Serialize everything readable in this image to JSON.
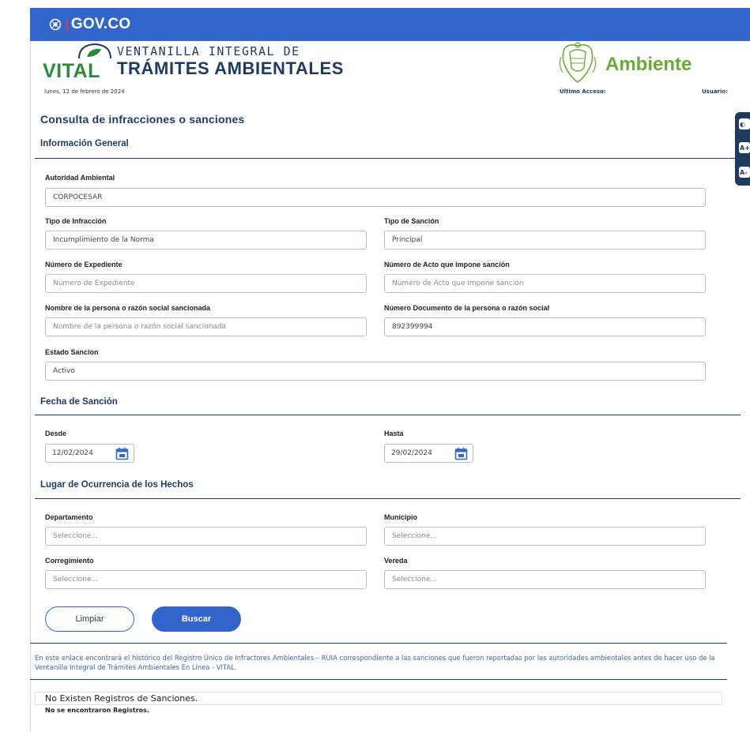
{
  "gov": {
    "brand": "GOV.CO"
  },
  "header": {
    "vital_word": "VITAL",
    "vital_line1": "VENTANILLA INTEGRAL DE",
    "vital_line2": "TRÁMITES AMBIENTALES",
    "date": "lunes, 12 de febrero de 2024",
    "ministry": "Ambiente",
    "last_access_label": "Último Acceso:",
    "user_label": "Usuario:"
  },
  "page": {
    "title": "Consulta de infracciones o sanciones"
  },
  "general": {
    "title": "Información General",
    "autoridad": {
      "label": "Autoridad Ambiental",
      "value": "CORPOCESAR"
    },
    "tipo_infraccion": {
      "label": "Tipo de Infracción",
      "value": "Incumplimiento de la Norma"
    },
    "tipo_sancion": {
      "label": "Tipo de Sanción",
      "value": "Principal"
    },
    "num_expediente": {
      "label": "Número de Expediente",
      "placeholder": "Número de Expediente"
    },
    "num_acto": {
      "label": "Número de Acto que impone sanción",
      "placeholder": "Número de Acto que impone sanción"
    },
    "nombre_persona": {
      "label": "Nombre de la persona o razón social sancionada",
      "placeholder": "Nombre de la persona o razón social sancionada"
    },
    "num_documento": {
      "label": "Número Documento de la persona o razón social",
      "value": "892399994"
    },
    "estado": {
      "label": "Estado Sancion",
      "value": "Activo"
    }
  },
  "fecha": {
    "title": "Fecha de Sanción",
    "desde": {
      "label": "Desde",
      "value": "12/02/2024"
    },
    "hasta": {
      "label": "Hasta",
      "value": "29/02/2024"
    }
  },
  "lugar": {
    "title": "Lugar de Ocurrencia de los Hechos",
    "departamento": {
      "label": "Departamento",
      "value": "Seleccione..."
    },
    "municipio": {
      "label": "Municipio",
      "value": "Seleccione..."
    },
    "corregimiento": {
      "label": "Corregimiento",
      "value": "Seleccione..."
    },
    "vereda": {
      "label": "Vereda",
      "value": "Seleccione..."
    }
  },
  "actions": {
    "limpiar": "Limpiar",
    "buscar": "Buscar"
  },
  "ruia": {
    "text": "En este enlace encontrará el histórico del Registro Único de Infractores Ambientales – RUIA correspondiente a las sanciones que fueron reportadas por las autoridades ambientales antes de hacer uso de la Ventanilla Integral de Trámites Ambientales En Línea - VITAL."
  },
  "results": {
    "empty_title": "No Existen Registros de Sanciones.",
    "empty_sub": "No se encontraron Registros."
  },
  "tools": {
    "contrast": "◐",
    "font_increase": "A+",
    "font_decrease": "A-"
  },
  "colors": {
    "gov_blue": "#3366cc",
    "navy": "#1f3a5f",
    "green": "#2b8a3e",
    "ambiente_green": "#6aaa36"
  }
}
